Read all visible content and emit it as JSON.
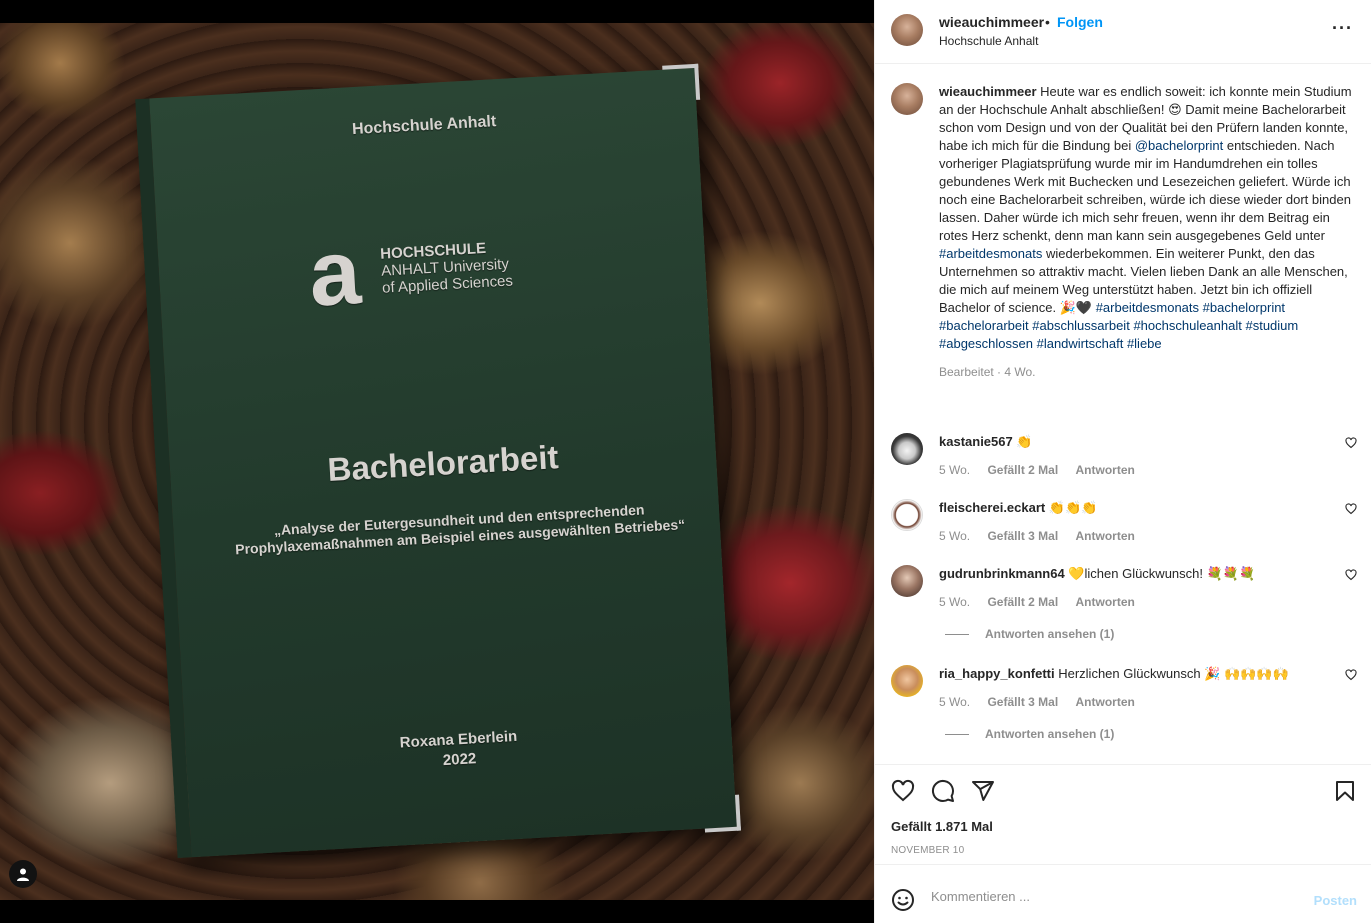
{
  "media": {
    "book": {
      "university": "Hochschule Anhalt",
      "logo_letter": "a",
      "logo_line1": "HOCHSCHULE",
      "logo_line2": "ANHALT University",
      "logo_line3": "of Applied Sciences",
      "title": "Bachelorarbeit",
      "subtitle": "„Analyse der Eutergesundheit und den entsprechenden Prophylaxemaßnahmen am Beispiel eines ausgewählten Betriebes“",
      "author": "Roxana Eberlein",
      "year": "2022"
    }
  },
  "header": {
    "username": "wieauchimmeer",
    "separator": "•",
    "follow_label": "Folgen",
    "location": "Hochschule Anhalt",
    "more_label": "···"
  },
  "caption": {
    "username": "wieauchimmeer",
    "part1": "Heute war es endlich soweit: ich konnte mein Studium an der Hochschule Anhalt abschließen! 😍 Damit meine Bachelorarbeit schon vom Design und von der Qualität bei den Prüfern landen konnte, habe ich mich für die Bindung bei",
    "mention": "@bachelorprint",
    "part2": "entschieden. Nach vorheriger Plagiatsprüfung wurde mir im Handumdrehen ein tolles gebundenes Werk mit Buchecken und Lesezeichen geliefert. Würde ich noch eine Bachelorarbeit schreiben, würde ich diese wieder dort binden lassen. Daher würde ich mich sehr freuen, wenn ihr dem Beitrag ein rotes Herz schenkt, denn man kann sein ausgegebenes Geld unter",
    "hashtag_inline": "#arbeitdesmonats",
    "part3": "wiederbekommen. Ein weiterer Punkt, den das Unternehmen so attraktiv macht. Vielen lieben Dank an alle Menschen, die mich auf meinem Weg unterstützt haben. Jetzt bin ich offiziell Bachelor of science. 🎉🖤",
    "hashtags": [
      "#arbeitdesmonats",
      "#bachelorprint",
      "#bachelorarbeit",
      "#abschlussarbeit",
      "#hochschuleanhalt",
      "#studium",
      "#abgeschlossen",
      "#landwirtschaft",
      "#liebe"
    ],
    "meta": "Bearbeitet · 4 Wo."
  },
  "comments": [
    {
      "username": "kastanie567",
      "text": "👏",
      "age": "5 Wo.",
      "likes": "Gefällt 2 Mal",
      "reply": "Antworten"
    },
    {
      "username": "fleischerei.eckart",
      "text": "👏👏👏",
      "age": "5 Wo.",
      "likes": "Gefällt 3 Mal",
      "reply": "Antworten"
    },
    {
      "username": "gudrunbrinkmann64",
      "text": "💛lichen Glückwunsch! 💐💐💐",
      "age": "5 Wo.",
      "likes": "Gefällt 2 Mal",
      "reply": "Antworten",
      "view_replies": "Antworten ansehen (1)"
    },
    {
      "username": "ria_happy_konfetti",
      "text": "Herzlichen Glückwunsch 🎉 🙌🙌🙌🙌",
      "age": "5 Wo.",
      "likes": "Gefällt 3 Mal",
      "reply": "Antworten",
      "view_replies": "Antworten ansehen (1)"
    }
  ],
  "actions": {
    "likes": "Gefällt 1.871 Mal",
    "date": "NOVEMBER 10"
  },
  "comment_box": {
    "placeholder": "Kommentieren ...",
    "post_label": "Posten"
  },
  "colors": {
    "accent": "#0095f6",
    "link": "#00376b",
    "muted": "#8e8e8e",
    "post_disabled": "#b2dffc",
    "book_green": "#223a2c"
  },
  "icons": [
    "user-tag-icon",
    "more-icon",
    "heart-icon",
    "comment-icon",
    "share-icon",
    "bookmark-icon",
    "emoji-icon"
  ]
}
